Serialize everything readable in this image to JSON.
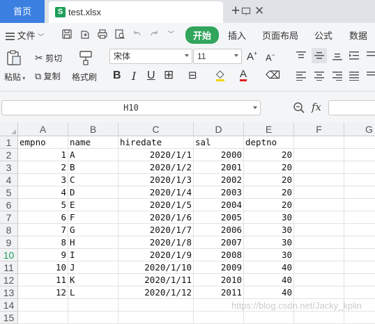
{
  "tabs": {
    "home": "首页",
    "file": "test.xlsx"
  },
  "menu": {
    "file_label": "文件",
    "tabs": [
      "开始",
      "插入",
      "页面布局",
      "公式",
      "数据"
    ]
  },
  "ribbon": {
    "paste": "粘贴",
    "cut": "剪切",
    "copy": "复制",
    "format_painter": "格式刷",
    "font_name": "宋体",
    "font_size": "11"
  },
  "formula_bar": {
    "name_box": "H10",
    "fx": "fx"
  },
  "grid": {
    "columns": [
      "A",
      "B",
      "C",
      "D",
      "E",
      "F",
      "G"
    ],
    "rows": [
      [
        "empno",
        "name",
        "hiredate",
        "sal",
        "deptno"
      ],
      [
        "1",
        "A",
        "2020/1/1",
        "2000",
        "20"
      ],
      [
        "2",
        "B",
        "2020/1/2",
        "2001",
        "20"
      ],
      [
        "3",
        "C",
        "2020/1/3",
        "2002",
        "20"
      ],
      [
        "4",
        "D",
        "2020/1/4",
        "2003",
        "20"
      ],
      [
        "5",
        "E",
        "2020/1/5",
        "2004",
        "20"
      ],
      [
        "6",
        "F",
        "2020/1/6",
        "2005",
        "30"
      ],
      [
        "7",
        "G",
        "2020/1/7",
        "2006",
        "30"
      ],
      [
        "8",
        "H",
        "2020/1/8",
        "2007",
        "30"
      ],
      [
        "9",
        "I",
        "2020/1/9",
        "2008",
        "30"
      ],
      [
        "10",
        "J",
        "2020/1/10",
        "2009",
        "40"
      ],
      [
        "11",
        "K",
        "2020/1/11",
        "2010",
        "40"
      ],
      [
        "12",
        "L",
        "2020/1/12",
        "2011",
        "40"
      ],
      [
        "",
        "",
        "",
        "",
        ""
      ],
      [
        "",
        "",
        "",
        "",
        ""
      ]
    ],
    "row_numbers": [
      "1",
      "2",
      "3",
      "4",
      "5",
      "6",
      "7",
      "8",
      "9",
      "10",
      "11",
      "12",
      "13",
      "14",
      "15"
    ],
    "selected_row": "10"
  },
  "watermark": "https://blog.csdn.net/Jacky_kplin",
  "colors": {
    "home_tab": "#3b7fe0",
    "start_tab": "#31a55c",
    "excel_green": "#1f9d5a"
  }
}
